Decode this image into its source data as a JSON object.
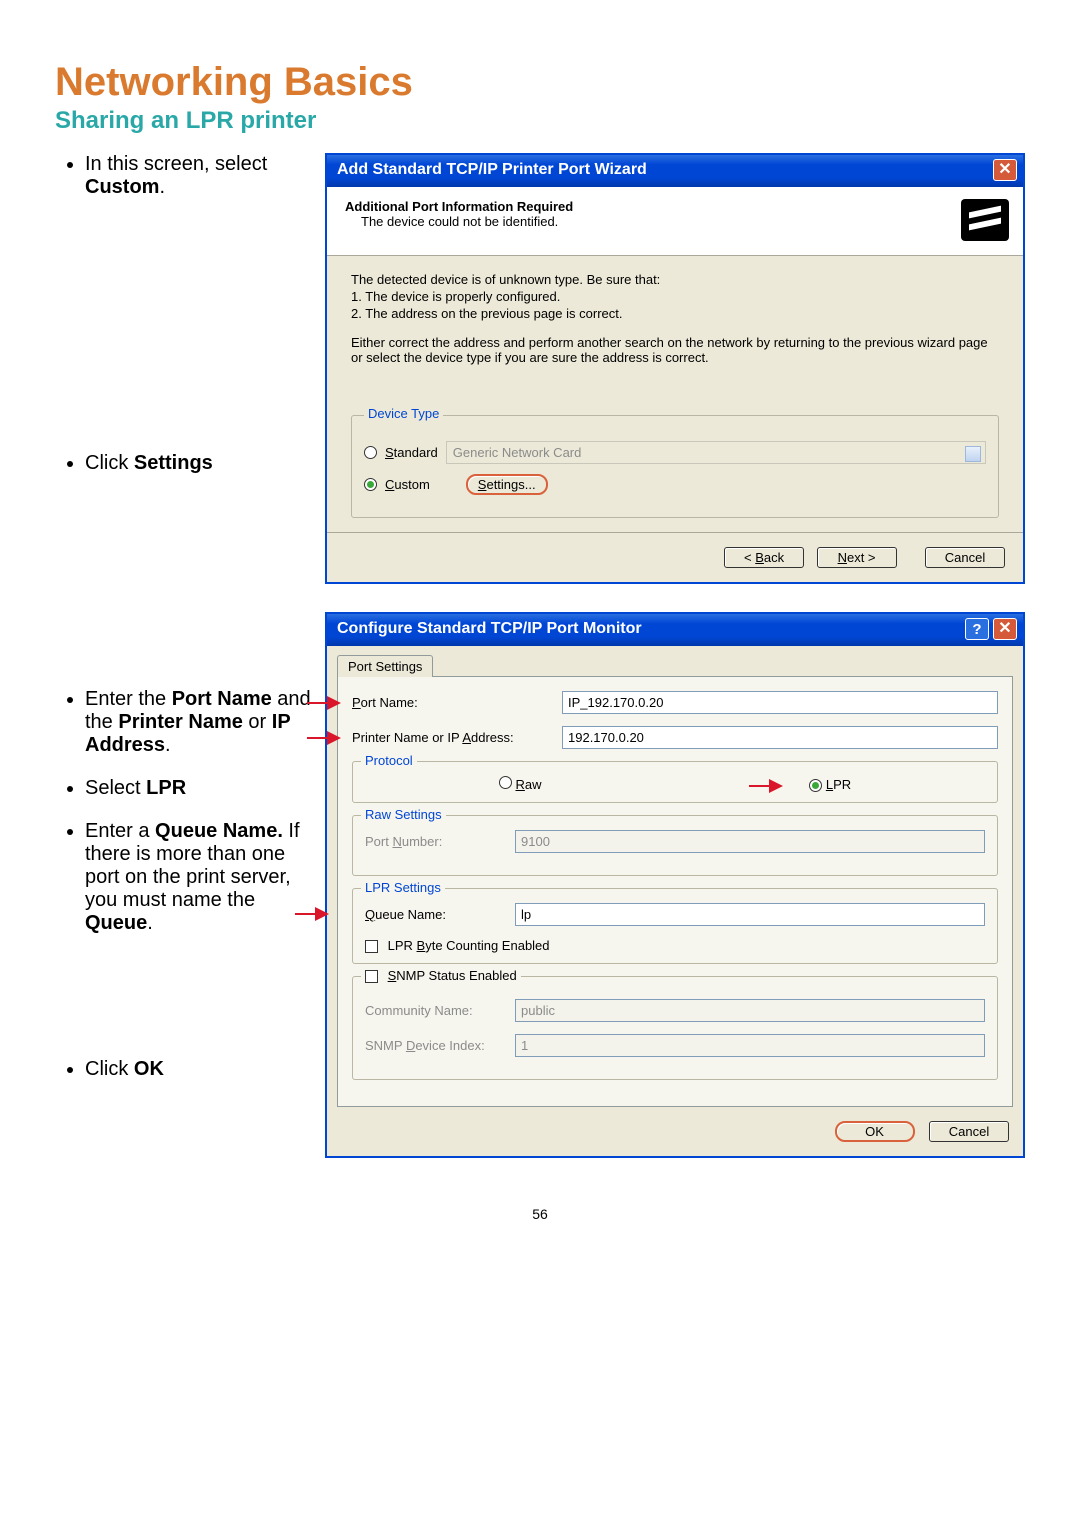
{
  "page": {
    "title": "Networking Basics",
    "subtitle": "Sharing an LPR printer",
    "number": "56"
  },
  "instructions": {
    "i1a": "In this screen, select ",
    "i1b": "Custom",
    "i1c": ".",
    "i2a": "Click ",
    "i2b": "Settings",
    "i3a": "Enter the ",
    "i3b": "Port Name",
    "i3c": " and the ",
    "i3d": "Printer Name",
    "i3e": " or ",
    "i3f": "IP Address",
    "i3g": ".",
    "i4a": "Select ",
    "i4b": "LPR",
    "i5a": "Enter a ",
    "i5b": "Queue Name.",
    "i5c": "  If there is more than one port on the print server, you must name the ",
    "i5d": "Queue",
    "i5e": ".",
    "i6a": "Click ",
    "i6b": "OK"
  },
  "wizard": {
    "title": "Add Standard TCP/IP Printer Port Wizard",
    "header_bold": "Additional Port Information Required",
    "header_sub": "The device could not be identified.",
    "body_intro1": "The detected device is of unknown type.  Be sure that:",
    "body_intro2": "1.  The device is properly configured.",
    "body_intro3": "2.  The address on the previous page is correct.",
    "body_p2": "Either correct the address and perform another search on the network by returning to the previous wizard page or select the device type if you are sure the address is correct.",
    "device_type_legend": "Device Type",
    "radio_standard": "tandard",
    "radio_standard_u": "S",
    "standard_dropdown": "Generic Network Card",
    "radio_custom": "ustom",
    "radio_custom_u": "C",
    "settings_btn": "ettings...",
    "settings_btn_u": "S",
    "back": "< ",
    "back_u": "B",
    "back_t": "ack",
    "next_u": "N",
    "next_t": "ext >",
    "cancel": "Cancel"
  },
  "config": {
    "title": "Configure Standard TCP/IP Port Monitor",
    "tab": "Port Settings",
    "port_name_lbl_u": "P",
    "port_name_lbl": "ort Name:",
    "port_name_val": "IP_192.170.0.20",
    "ip_lbl_a": "Printer Name or IP ",
    "ip_lbl_u": "A",
    "ip_lbl_b": "ddress:",
    "ip_val": "192.170.0.20",
    "protocol_legend": "Protocol",
    "raw_u": "R",
    "raw_t": "aw",
    "lpr_u": "L",
    "lpr_t": "PR",
    "raw_settings_legend": "Raw Settings",
    "port_number_lbl": "Port ",
    "port_number_u": "N",
    "port_number_lbl2": "umber:",
    "port_number_val": "9100",
    "lpr_settings_legend": "LPR Settings",
    "queue_lbl_u": "Q",
    "queue_lbl": "ueue Name:",
    "queue_val": "lp",
    "lpr_byte_u": "B",
    "lpr_byte_a": "LPR ",
    "lpr_byte_b": "yte Counting Enabled",
    "snmp_u": "S",
    "snmp_t": "NMP Status Enabled",
    "community_lbl": "Community Name:",
    "community_val": "public",
    "snmp_index_lbl": "SNMP ",
    "snmp_index_u": "D",
    "snmp_index_lbl2": "evice Index:",
    "snmp_index_val": "1",
    "ok": "OK",
    "cancel": "Cancel"
  }
}
